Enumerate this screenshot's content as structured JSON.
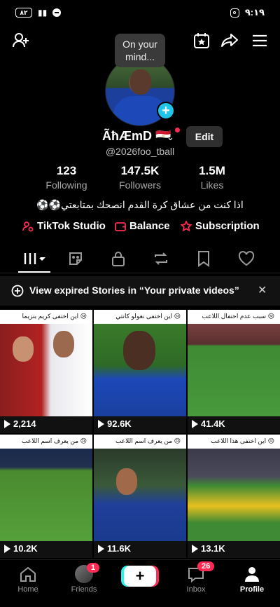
{
  "status_bar": {
    "battery": "٨٢",
    "time": "٩:١٩"
  },
  "top_bar": {
    "bubble_text": "On your mind..."
  },
  "profile": {
    "display_name": "ÃħÆmD 🇪🇬",
    "edit_label": "Edit",
    "username": "@2026foo_tball",
    "stats": [
      {
        "value": "123",
        "label": "Following"
      },
      {
        "value": "147.5K",
        "label": "Followers"
      },
      {
        "value": "1.5M",
        "label": "Likes"
      }
    ],
    "bio": "اذا كنت من عشاق كرة القدم انصحك بمتابعتي⚽⚽",
    "links": [
      {
        "label": "TikTok Studio",
        "icon": "person-gear-icon"
      },
      {
        "label": "Balance",
        "icon": "wallet-icon"
      },
      {
        "label": "Subscription",
        "icon": "star-badge-icon"
      }
    ]
  },
  "banner": {
    "text": "View expired Stories in “Your private videos”"
  },
  "videos": [
    {
      "caption": "😢 اين اختفى كريم بنزيما",
      "views": "2,214"
    },
    {
      "caption": "😢 اين اختفى نغولو كانتي",
      "views": "92.6K"
    },
    {
      "caption": "😢 سبب عدم احتفال اللاعب",
      "views": "41.4K"
    },
    {
      "caption": "😢 من يعرف اسم اللاعب",
      "views": "10.2K"
    },
    {
      "caption": "😢 من يعرف اسم اللاعب",
      "views": "11.6K"
    },
    {
      "caption": "😢 اين اختفى هذا اللاعب",
      "views": "13.1K"
    }
  ],
  "bottom_nav": {
    "home": "Home",
    "friends": "Friends",
    "friends_badge": "1",
    "inbox": "Inbox",
    "inbox_badge": "26",
    "profile": "Profile"
  },
  "colors": {
    "accent_red": "#fe2c55",
    "accent_cyan": "#25f4ee",
    "background": "#000000"
  }
}
